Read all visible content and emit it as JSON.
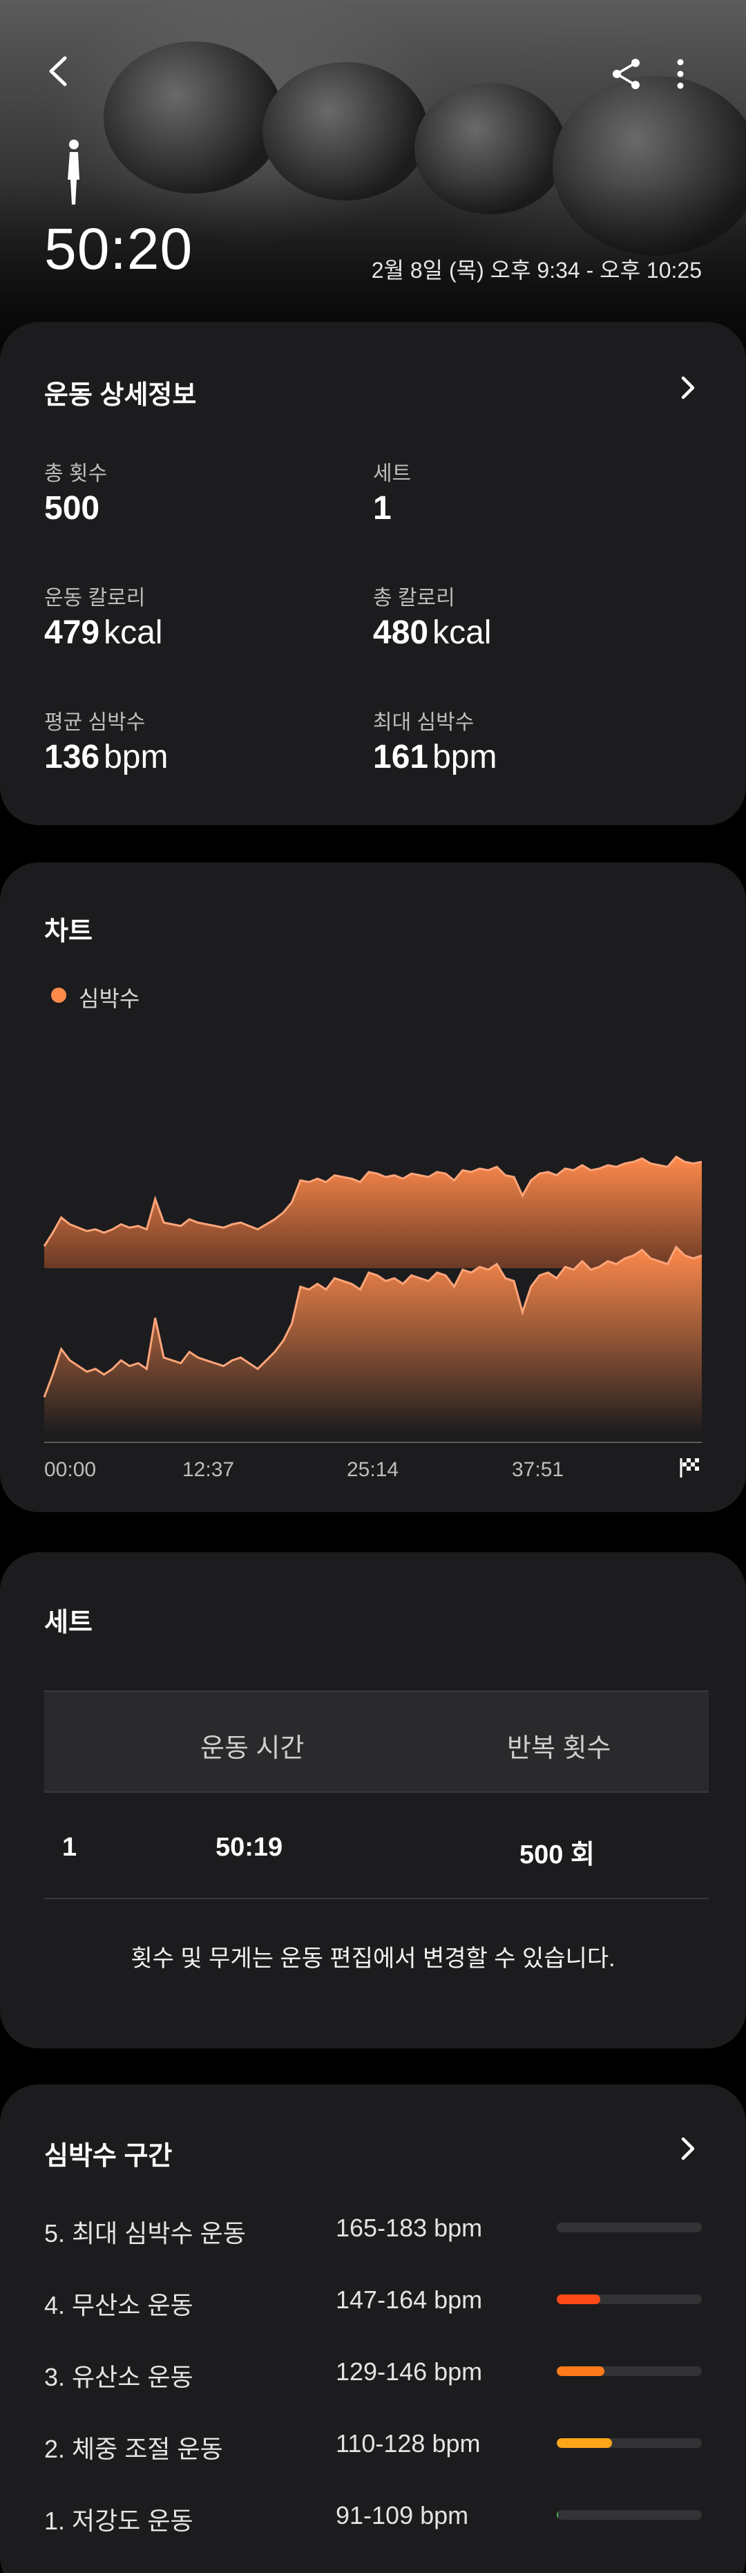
{
  "header": {
    "duration": "50:20",
    "date_range": "2월 8일 (목) 오후 9:34 - 오후 10:25",
    "icons": [
      "back-arrow-icon",
      "share-icon",
      "more-vert-icon",
      "standing-person-icon"
    ]
  },
  "details": {
    "title": "운동 상세정보",
    "metrics": [
      {
        "label": "총 횟수",
        "value": "500",
        "unit": ""
      },
      {
        "label": "세트",
        "value": "1",
        "unit": ""
      },
      {
        "label": "운동 칼로리",
        "value": "479",
        "unit": "kcal"
      },
      {
        "label": "총 칼로리",
        "value": "480",
        "unit": "kcal"
      },
      {
        "label": "평균 심박수",
        "value": "136",
        "unit": "bpm"
      },
      {
        "label": "최대 심박수",
        "value": "161",
        "unit": "bpm"
      }
    ]
  },
  "chart_section": {
    "title": "차트",
    "legend": "심박수"
  },
  "chart_data": {
    "type": "area",
    "title": "차트",
    "series": [
      {
        "name": "심박수",
        "color": "#ff8a4c",
        "values": [
          108,
          116,
          125,
          121,
          119,
          117,
          118,
          116,
          118,
          121,
          119,
          120,
          118,
          136,
          122,
          121,
          120,
          124,
          122,
          121,
          120,
          119,
          121,
          122,
          120,
          118,
          121,
          124,
          128,
          134,
          147,
          146,
          148,
          146,
          150,
          149,
          148,
          146,
          152,
          151,
          149,
          150,
          148,
          151,
          150,
          149,
          152,
          151,
          147,
          153,
          152,
          154,
          153,
          155,
          150,
          149,
          138,
          147,
          151,
          152,
          150,
          154,
          153,
          156,
          153,
          154,
          156,
          155,
          157,
          158,
          160,
          157,
          156,
          155,
          161,
          158,
          157,
          158
        ]
      }
    ],
    "x_ticks": [
      "00:00",
      "12:37",
      "25:14",
      "37:51"
    ],
    "end_marker_icon": "finish-flag-icon",
    "ylim": [
      95,
      165
    ],
    "grid": false
  },
  "sets": {
    "title": "세트",
    "columns": [
      "운동 시간",
      "반복 횟수"
    ],
    "rows": [
      {
        "set": "1",
        "time": "50:19",
        "reps": "500 회"
      }
    ],
    "note": "횟수 및 무게는 운동 편집에서 변경할 수 있습니다."
  },
  "hr_zones": {
    "title": "심박수 구간",
    "zones": [
      {
        "name": "5. 최대 심박수 운동",
        "range": "165-183 bpm",
        "fraction": 0.0,
        "color": "#e0342b"
      },
      {
        "name": "4. 무산소 운동",
        "range": "147-164 bpm",
        "fraction": 0.3,
        "color": "#ff4a17"
      },
      {
        "name": "3. 유산소 운동",
        "range": "129-146 bpm",
        "fraction": 0.33,
        "color": "#ff7a1a"
      },
      {
        "name": "2. 체중 조절 운동",
        "range": "110-128 bpm",
        "fraction": 0.38,
        "color": "#ffa51a"
      },
      {
        "name": "1. 저강도 운동",
        "range": "91-109 bpm",
        "fraction": 0.01,
        "color": "#4caf50"
      }
    ]
  }
}
